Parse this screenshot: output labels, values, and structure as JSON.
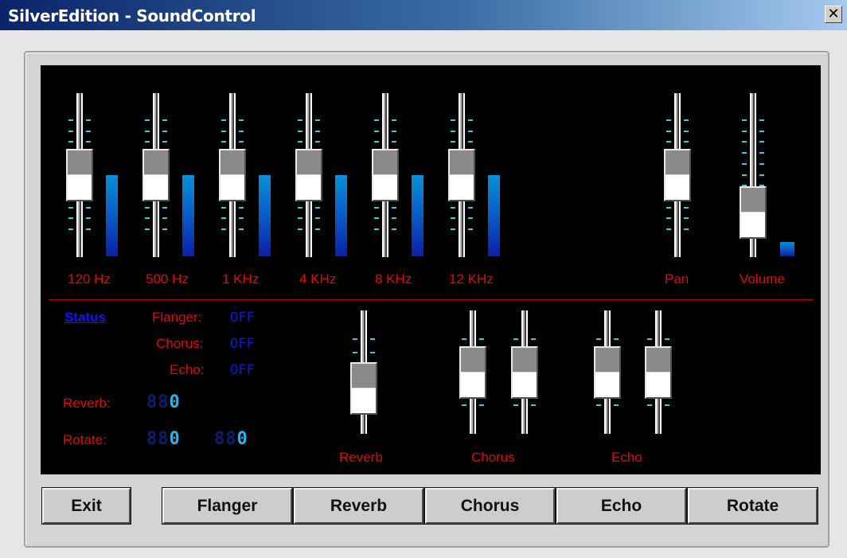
{
  "window": {
    "title": "SilverEdition - SoundControl",
    "close_glyph": "✕"
  },
  "equalizer": {
    "bands": [
      {
        "label": "120 Hz",
        "position": 0.5,
        "level": 0.5
      },
      {
        "label": "500 Hz",
        "position": 0.5,
        "level": 0.5
      },
      {
        "label": "1 KHz",
        "position": 0.5,
        "level": 0.5
      },
      {
        "label": "4 KHz",
        "position": 0.5,
        "level": 0.5
      },
      {
        "label": "8 KHz",
        "position": 0.5,
        "level": 0.5
      },
      {
        "label": "12 KHz",
        "position": 0.5,
        "level": 0.5
      }
    ]
  },
  "pan": {
    "label": "Pan",
    "position": 0.5
  },
  "volume": {
    "label": "Volume",
    "position": 0.15,
    "level": 0.09
  },
  "status": {
    "link": "Status",
    "flanger_label": "Flanger:",
    "flanger_value": "OFF",
    "chorus_label": "Chorus:",
    "chorus_value": "OFF",
    "echo_label": "Echo:",
    "echo_value": "OFF",
    "reverb_label": "Reverb:",
    "reverb_dim": "88",
    "reverb_value": "0",
    "rotate_label": "Rotate:",
    "rotate1_dim": "88",
    "rotate1_value": "0",
    "rotate2_dim": "88",
    "rotate2_value": "0"
  },
  "effects": {
    "reverb": {
      "label": "Reverb",
      "position": 0.25
    },
    "chorus": {
      "label": "Chorus",
      "positions": [
        0.5,
        0.5
      ]
    },
    "echo": {
      "label": "Echo",
      "positions": [
        0.5,
        0.5
      ]
    }
  },
  "buttons": {
    "exit": "Exit",
    "flanger": "Flanger",
    "reverb": "Reverb",
    "chorus": "Chorus",
    "echo": "Echo",
    "rotate": "Rotate"
  },
  "colors": {
    "label_red": "#e20707",
    "tick_cyan": "#37c8e4",
    "status_blue": "#0f16d8",
    "panel_bg": "#000000"
  }
}
